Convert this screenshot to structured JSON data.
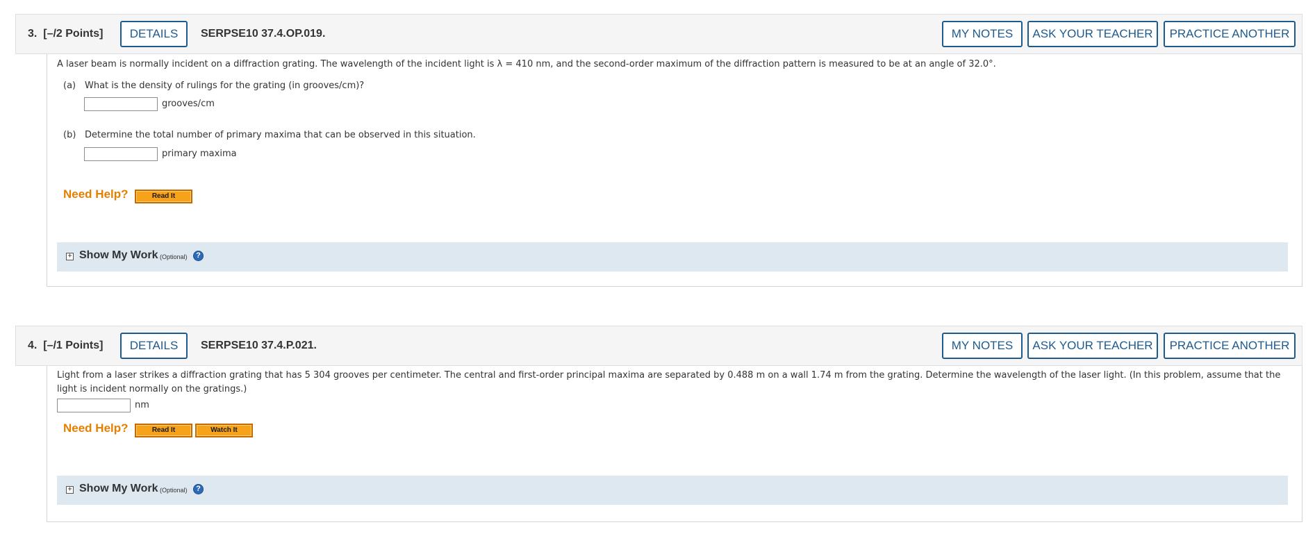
{
  "header_buttons": {
    "details": "DETAILS",
    "my_notes": "MY NOTES",
    "ask_teacher": "ASK YOUR TEACHER",
    "practice_another": "PRACTICE ANOTHER"
  },
  "help": {
    "need_help": "Need Help?",
    "read_it": "Read It",
    "watch_it": "Watch It"
  },
  "show_my_work": {
    "title": "Show My Work",
    "optional": "(Optional)",
    "toggle": "+",
    "help": "?"
  },
  "questions": [
    {
      "number": "3.",
      "points": "[–/2 Points]",
      "code": "SERPSE10 37.4.OP.019.",
      "prompt": "A laser beam is normally incident on a diffraction grating. The wavelength of the incident light is λ = 410 nm, and the second-order maximum of the diffraction pattern is measured to be at an angle of 32.0°.",
      "parts": [
        {
          "label": "(a)",
          "question": "What is the density of rulings for the grating (in grooves/cm)?",
          "value": "",
          "unit": "grooves/cm"
        },
        {
          "label": "(b)",
          "question": "Determine the total number of primary maxima that can be observed in this situation.",
          "value": "",
          "unit": "primary maxima"
        }
      ]
    },
    {
      "number": "4.",
      "points": "[–/1 Points]",
      "code": "SERPSE10 37.4.P.021.",
      "prompt_line1": "Light from a laser strikes a diffraction grating that has 5 304 grooves per centimeter. The central and first-order principal maxima are separated by 0.488 m on a wall 1.74 m from the grating. Determine the wavelength of the laser light. (In this problem, assume that the",
      "prompt_line2": "light is incident normally on the gratings.)",
      "answer": {
        "value": "",
        "unit": "nm"
      }
    }
  ]
}
